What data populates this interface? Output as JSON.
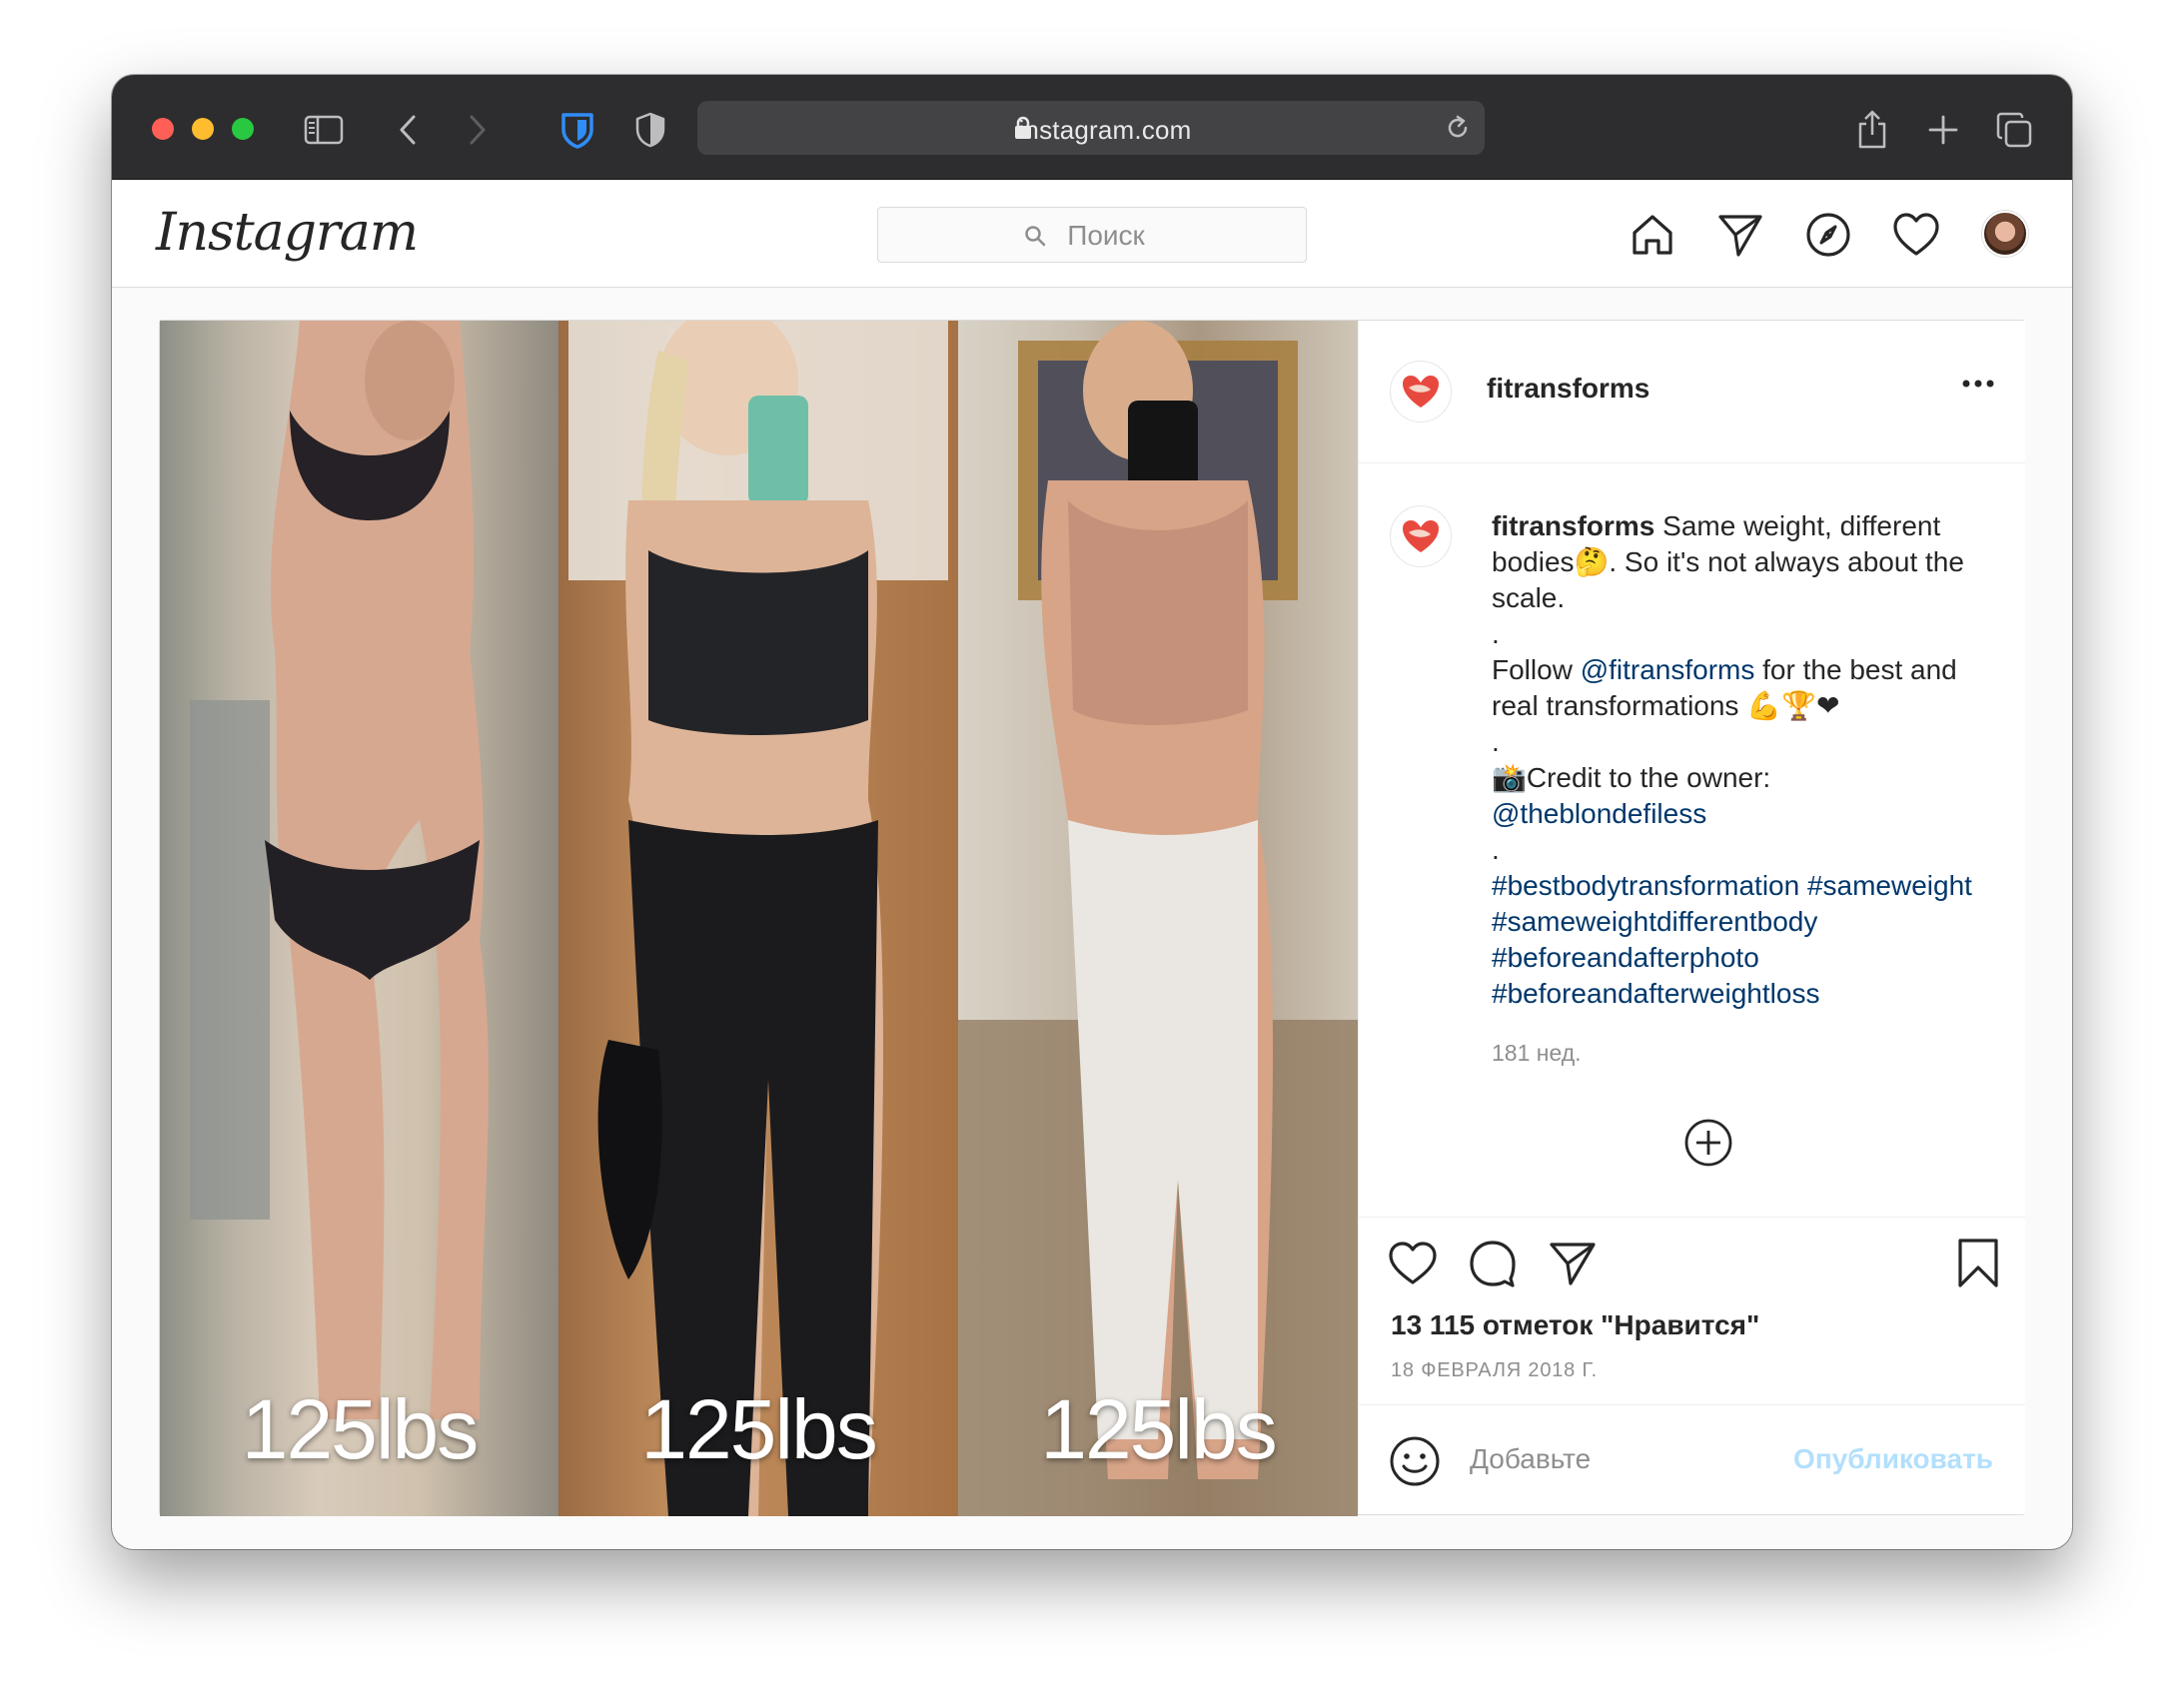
{
  "browser": {
    "url": "instagram.com",
    "traffic_lights": [
      "close",
      "minimize",
      "zoom"
    ],
    "icons": [
      "sidebar-icon",
      "back-icon",
      "forward-icon",
      "bitwarden-shield-icon",
      "privacy-shield-icon",
      "lock-icon",
      "reload-icon",
      "share-icon",
      "new-tab-icon",
      "tabs-overview-icon"
    ]
  },
  "header": {
    "logo": "Instagram",
    "search_placeholder": "Поиск",
    "nav_icons": [
      "home-icon",
      "direct-icon",
      "explore-icon",
      "activity-heart-icon",
      "profile-avatar"
    ]
  },
  "post": {
    "image_labels": [
      "125lbs",
      "125lbs",
      "125lbs"
    ],
    "account": "fitransforms",
    "caption": {
      "username": "fitransforms",
      "line1": "Same weight, different bodies🤔. So it's not always about the scale.",
      "dot1": ".",
      "follow_prefix": "Follow ",
      "follow_link": "@fitransforms",
      "follow_suffix": " for the best and real transformations 💪🏆❤",
      "dot2": ".",
      "credit": "📸Credit to the owner:",
      "credit_link": "@theblondefiless",
      "dot3": ".",
      "hashtags": "#bestbodytransformation #sameweight #sameweightdifferentbody #beforeandafterphoto #beforeandafterweightloss"
    },
    "time_ago": "181 нед.",
    "likes": "13 115 отметок \"Нравится\"",
    "date": "18 ФЕВРАЛЯ 2018 Г.",
    "comment_placeholder": "Добавьте",
    "publish_label": "Опубликовать"
  },
  "colors": {
    "link": "#00376b",
    "publish_disabled": "#b2dffc",
    "toolbar_bg": "#2d2d2f"
  }
}
